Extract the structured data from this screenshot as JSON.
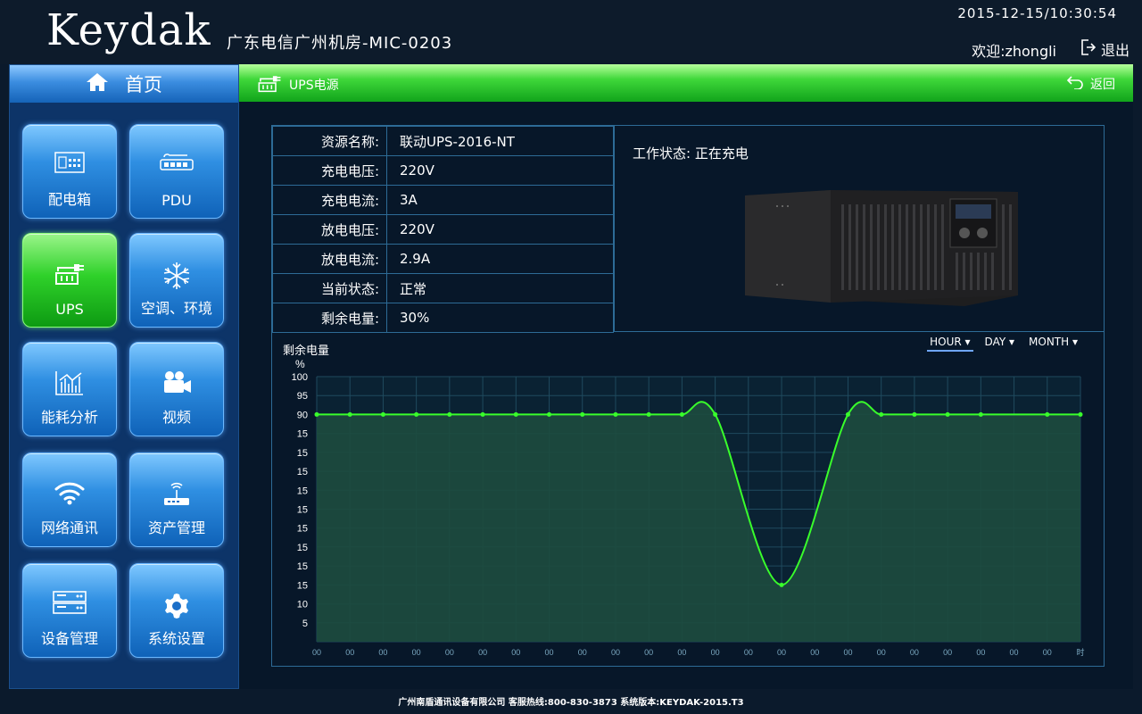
{
  "header": {
    "logo": "Keydak",
    "site_name": "广东电信广州机房-MIC-0203",
    "datetime": "2015-12-15/10:30:54",
    "welcome": "欢迎:zhongli",
    "logout_label": "退出"
  },
  "sidebar": {
    "home_label": "首页",
    "tiles": [
      {
        "label": "配电箱",
        "icon": "distribution-box-icon",
        "active": false
      },
      {
        "label": "PDU",
        "icon": "pdu-icon",
        "active": false
      },
      {
        "label": "UPS",
        "icon": "ups-icon",
        "active": true
      },
      {
        "label": "空调、环境",
        "icon": "snowflake-icon",
        "active": false
      },
      {
        "label": "能耗分析",
        "icon": "bar-chart-icon",
        "active": false
      },
      {
        "label": "视频",
        "icon": "video-camera-icon",
        "active": false
      },
      {
        "label": "网络通讯",
        "icon": "wifi-icon",
        "active": false
      },
      {
        "label": "资产管理",
        "icon": "router-icon",
        "active": false
      },
      {
        "label": "设备管理",
        "icon": "server-icon",
        "active": false
      },
      {
        "label": "系统设置",
        "icon": "gear-icon",
        "active": false
      }
    ]
  },
  "main": {
    "title": "UPS电源",
    "back_label": "返回",
    "info_rows": [
      {
        "key": "资源名称:",
        "value": "联动UPS-2016-NT"
      },
      {
        "key": "充电电压:",
        "value": "220V"
      },
      {
        "key": "充电电流:",
        "value": "3A"
      },
      {
        "key": "放电电压:",
        "value": "220V"
      },
      {
        "key": "放电电流:",
        "value": "2.9A"
      },
      {
        "key": "当前状态:",
        "value": "正常"
      },
      {
        "key": "剩余电量:",
        "value": "30%"
      }
    ],
    "work_status": "工作状态: 正在充电"
  },
  "chart_data": {
    "type": "area",
    "title": "剩余电量",
    "ylabel": "%",
    "ytick_labels": [
      "100",
      "95",
      "90",
      "15",
      "15",
      "15",
      "15",
      "15",
      "15",
      "15",
      "15",
      "15",
      "10",
      "5"
    ],
    "x": [
      "00",
      "00",
      "00",
      "00",
      "00",
      "00",
      "00",
      "00",
      "00",
      "00",
      "00",
      "00",
      "00",
      "00",
      "00",
      "00",
      "00",
      "00",
      "00",
      "00",
      "00",
      "00",
      "00",
      "时"
    ],
    "series": [
      {
        "values": [
          90,
          90,
          90,
          90,
          90,
          90,
          90,
          90,
          90,
          90,
          90,
          90,
          90,
          null,
          15,
          null,
          90,
          90,
          90,
          90,
          90,
          null,
          90,
          90
        ]
      }
    ],
    "range_tabs": [
      "HOUR ▾",
      "DAY ▾",
      "MONTH ▾"
    ],
    "selected_range": "HOUR ▾",
    "grid": true,
    "line_color": "#39ff2b",
    "fill_color": "#1d4b3e"
  },
  "footer": "广州南盾通讯设备有限公司 客服热线:800-830-3873 系统版本:KEYDAK-2015.T3"
}
